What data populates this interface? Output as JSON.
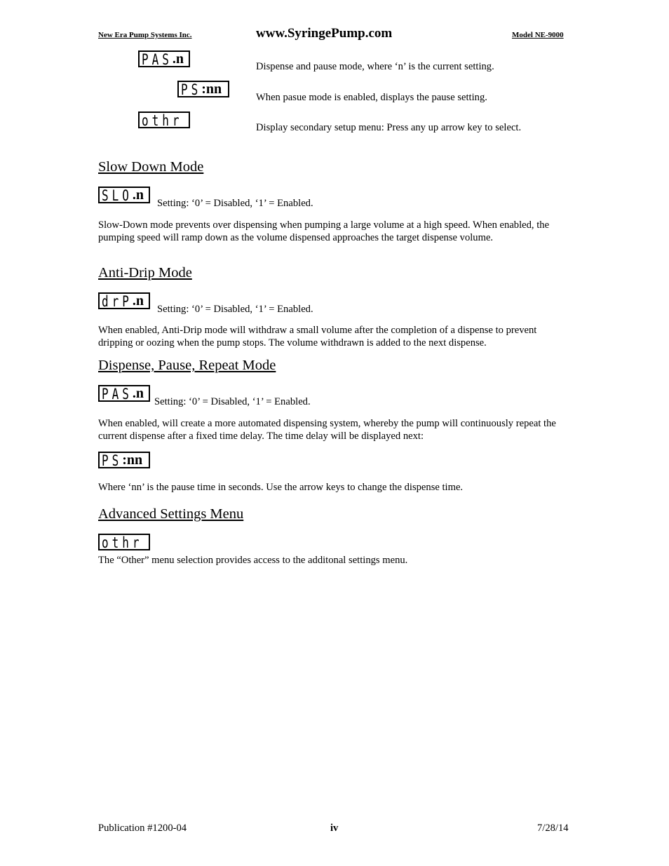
{
  "header": {
    "company": "New Era Pump Systems Inc.",
    "url": "www.SyringePump.com",
    "model": "Model NE-9000"
  },
  "top": [
    {
      "display": "PAS",
      "suffix": ".n",
      "text": "Dispense and pause mode, where ‘n’ is the current setting."
    },
    {
      "display": "PS",
      "suffix": ":nn",
      "text": "When pasue mode is enabled, displays the pause setting."
    },
    {
      "display": "othr",
      "suffix": "",
      "text": "Display secondary setup menu:  Press any up arrow key to select."
    }
  ],
  "sections": [
    {
      "title": "Slow Down Mode",
      "display": "SLO",
      "suffix": ".n",
      "setting": "Setting:  ‘0’ = Disabled, ‘1’ = Enabled.",
      "body": "Slow-Down mode prevents over dispensing when pumping a large volume at a high speed.  When enabled, the pumping speed will ramp down as the volume dispensed approaches the target dispense volume."
    },
    {
      "title": "Anti-Drip Mode",
      "display": "drP",
      "suffix": ".n",
      "setting": "Setting:  ‘0’ = Disabled, ‘1’ = Enabled.",
      "body": "When enabled, Anti-Drip mode will withdraw a small volume after the completion of a dispense to prevent dripping or oozing when the pump stops.  The volume withdrawn is added to the next dispense."
    },
    {
      "title": "Dispense, Pause, Repeat Mode",
      "display": "PAS",
      "suffix": ".n",
      "setting": "Setting:  ‘0’ = Disabled, ‘1’ = Enabled.",
      "body": "When enabled, will create a more automated dispensing system, whereby the pump will continuously repeat the current dispense after a fixed time delay.  The time delay will be displayed next:",
      "display2": "PS",
      "suffix2": ":nn",
      "body2": "Where ‘nn’ is the pause time in seconds.  Use the arrow keys to change the dispense time."
    },
    {
      "title": "Advanced Settings Menu",
      "display": "othr",
      "suffix": "",
      "body": "The “Other” menu selection provides access to the additonal settings menu."
    }
  ],
  "footer": {
    "publication": "Publication #1200-04",
    "page": "iv",
    "date": "7/28/14"
  }
}
